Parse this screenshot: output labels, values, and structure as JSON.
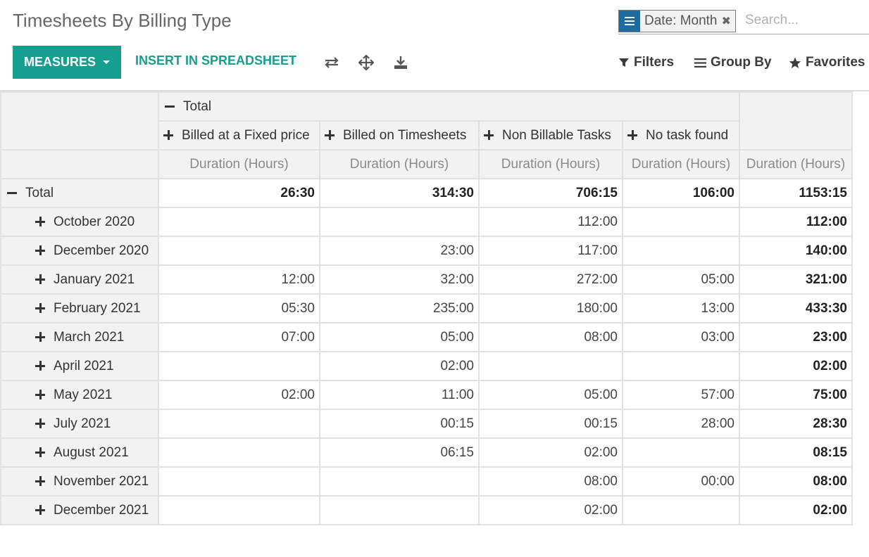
{
  "header": {
    "title": "Timesheets By Billing Type",
    "facet_value": "Date: Month",
    "search_placeholder": "Search..."
  },
  "toolbar": {
    "measures_label": "MEASURES",
    "insert_label": "INSERT IN SPREADSHEET",
    "tools": [
      "flip-axis-icon",
      "expand-all-icon",
      "download-icon"
    ],
    "filters_label": "Filters",
    "groupby_label": "Group By",
    "favorites_label": "Favorites"
  },
  "colors": {
    "primary": "#169e8e",
    "facet_blue": "#1d6ca1"
  },
  "pivot": {
    "col_total_label": "Total",
    "columns": [
      "Billed at a Fixed price",
      "Billed on Timesheets",
      "Non Billable Tasks",
      "No task found"
    ],
    "measure_label": "Duration (Hours)",
    "total_row": {
      "label": "Total",
      "values": [
        "26:30",
        "314:30",
        "706:15",
        "106:00"
      ],
      "total": "1153:15"
    },
    "rows": [
      {
        "label": "October 2020",
        "values": [
          "",
          "",
          "112:00",
          ""
        ],
        "total": "112:00"
      },
      {
        "label": "December 2020",
        "values": [
          "",
          "23:00",
          "117:00",
          ""
        ],
        "total": "140:00"
      },
      {
        "label": "January 2021",
        "values": [
          "12:00",
          "32:00",
          "272:00",
          "05:00"
        ],
        "total": "321:00"
      },
      {
        "label": "February 2021",
        "values": [
          "05:30",
          "235:00",
          "180:00",
          "13:00"
        ],
        "total": "433:30"
      },
      {
        "label": "March 2021",
        "values": [
          "07:00",
          "05:00",
          "08:00",
          "03:00"
        ],
        "total": "23:00"
      },
      {
        "label": "April 2021",
        "values": [
          "",
          "02:00",
          "",
          ""
        ],
        "total": "02:00"
      },
      {
        "label": "May 2021",
        "values": [
          "02:00",
          "11:00",
          "05:00",
          "57:00"
        ],
        "total": "75:00"
      },
      {
        "label": "July 2021",
        "values": [
          "",
          "00:15",
          "00:15",
          "28:00"
        ],
        "total": "28:30"
      },
      {
        "label": "August 2021",
        "values": [
          "",
          "06:15",
          "02:00",
          ""
        ],
        "total": "08:15"
      },
      {
        "label": "November 2021",
        "values": [
          "",
          "",
          "08:00",
          "00:00"
        ],
        "total": "08:00"
      },
      {
        "label": "December 2021",
        "values": [
          "",
          "",
          "02:00",
          ""
        ],
        "total": "02:00"
      }
    ]
  }
}
